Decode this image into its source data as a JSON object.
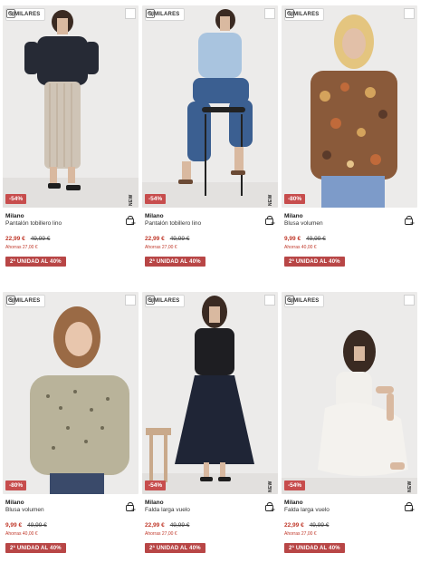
{
  "ui": {
    "similar_label": "SIMILARES",
    "icons": {
      "similar": "search-similar-icon",
      "favorite": "favorite-checkbox-icon",
      "cart": "add-to-cart-icon"
    },
    "colors": {
      "discount_badge": "#c74d4d",
      "price_now": "#c0392b",
      "promo_banner": "#b84646"
    }
  },
  "products": [
    {
      "brand": "Milano",
      "name": "Pantalón tobillero lino",
      "price_now": "22,99 €",
      "price_old": "49,99 €",
      "savings": "Ahorras 27,00 €",
      "discount": "-54%",
      "new_tag": "NEW",
      "promo": "2ª UNIDAD AL 40%"
    },
    {
      "brand": "Milano",
      "name": "Pantalón tobillero lino",
      "price_now": "22,99 €",
      "price_old": "49,99 €",
      "savings": "Ahorras 27,00 €",
      "discount": "-54%",
      "new_tag": "NEW",
      "promo": "2ª UNIDAD AL 40%"
    },
    {
      "brand": "Milano",
      "name": "Blusa volumen",
      "price_now": "9,99 €",
      "price_old": "49,99 €",
      "savings": "Ahorras 40,00 €",
      "discount": "-80%",
      "new_tag": "",
      "promo": "2ª UNIDAD AL 40%"
    },
    {
      "brand": "Milano",
      "name": "Blusa volumen",
      "price_now": "9,99 €",
      "price_old": "49,99 €",
      "savings": "Ahorras 40,00 €",
      "discount": "-80%",
      "new_tag": "",
      "promo": "2ª UNIDAD AL 40%"
    },
    {
      "brand": "Milano",
      "name": "Falda larga vuelo",
      "price_now": "22,99 €",
      "price_old": "49,99 €",
      "savings": "Ahorras 27,00 €",
      "discount": "-54%",
      "new_tag": "NEW",
      "promo": "2ª UNIDAD AL 40%"
    },
    {
      "brand": "Milano",
      "name": "Falda larga vuelo",
      "price_now": "22,99 €",
      "price_old": "49,99 €",
      "savings": "Ahorras 27,00 €",
      "discount": "-54%",
      "new_tag": "NEW",
      "promo": "2ª UNIDAD AL 40%"
    }
  ]
}
